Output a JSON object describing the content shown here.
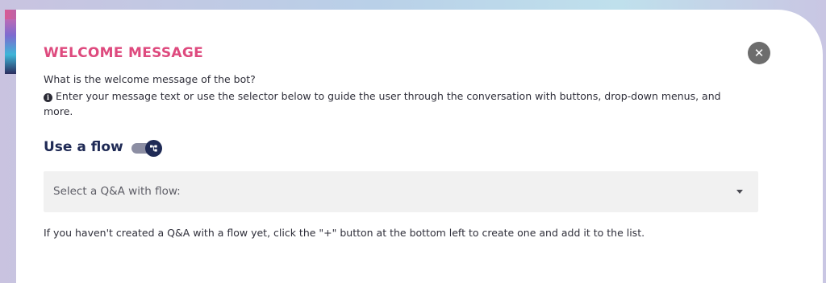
{
  "dialog": {
    "title": "WELCOME MESSAGE",
    "close_symbol": "✕",
    "question": "What is the welcome message of the bot?",
    "hint": "Enter your message text or use the selector below to guide the user through the conversation with buttons, drop-down menus, and more.",
    "info_icon_glyph": "i",
    "flow": {
      "label": "Use a flow",
      "toggle_on": true,
      "toggle_icon": "flow-hierarchy-icon"
    },
    "select": {
      "placeholder": "Select a Q&A with flow:",
      "options_visible": []
    },
    "footnote": "If you haven't created a Q&A with a flow yet, click the \"+\" button at the bottom left to create one and add it to the list."
  },
  "colors": {
    "title": "#de4a7e",
    "flow_label": "#1f2a55",
    "toggle_knob": "#1f2a55",
    "toggle_track": "#8c8ea3",
    "close_button": "#6d6d6d",
    "select_bg": "#f1f1f1"
  }
}
